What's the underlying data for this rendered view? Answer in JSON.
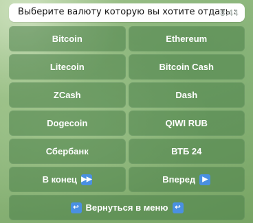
{
  "message": {
    "text": "Выберите валюту которую вы хотите отдать :",
    "time": "8:44"
  },
  "keyboard": {
    "rows": [
      [
        "Bitcoin",
        "Ethereum"
      ],
      [
        "Litecoin",
        "Bitcoin Cash"
      ],
      [
        "ZCash",
        "Dash"
      ],
      [
        "Dogecoin",
        "QIWI RUB"
      ],
      [
        "Сбербанк",
        "ВТБ 24"
      ]
    ],
    "to_end": "В конец",
    "forward": "Вперед",
    "back_to_menu": "Вернуться в меню"
  },
  "icons": {
    "to_end": "fast-forward-icon",
    "forward": "play-icon",
    "back_to_menu": "return-arrow-icon"
  }
}
